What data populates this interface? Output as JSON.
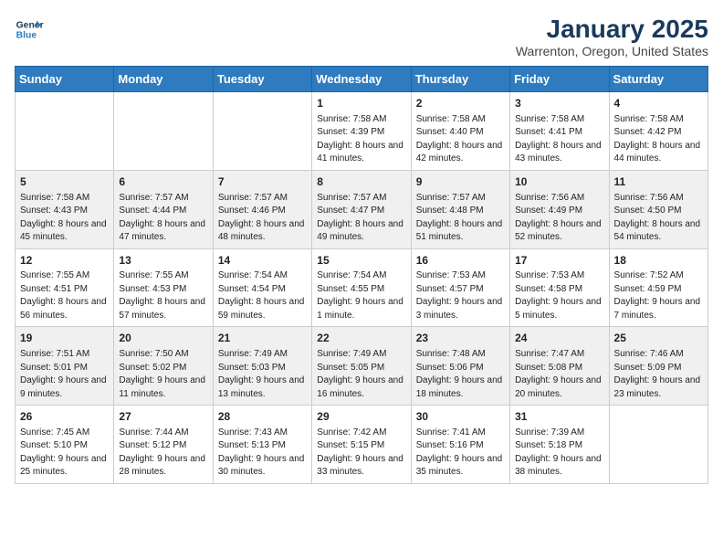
{
  "header": {
    "logo_line1": "General",
    "logo_line2": "Blue",
    "month": "January 2025",
    "location": "Warrenton, Oregon, United States"
  },
  "days_of_week": [
    "Sunday",
    "Monday",
    "Tuesday",
    "Wednesday",
    "Thursday",
    "Friday",
    "Saturday"
  ],
  "weeks": [
    [
      {
        "day": "",
        "info": ""
      },
      {
        "day": "",
        "info": ""
      },
      {
        "day": "",
        "info": ""
      },
      {
        "day": "1",
        "info": "Sunrise: 7:58 AM\nSunset: 4:39 PM\nDaylight: 8 hours and 41 minutes."
      },
      {
        "day": "2",
        "info": "Sunrise: 7:58 AM\nSunset: 4:40 PM\nDaylight: 8 hours and 42 minutes."
      },
      {
        "day": "3",
        "info": "Sunrise: 7:58 AM\nSunset: 4:41 PM\nDaylight: 8 hours and 43 minutes."
      },
      {
        "day": "4",
        "info": "Sunrise: 7:58 AM\nSunset: 4:42 PM\nDaylight: 8 hours and 44 minutes."
      }
    ],
    [
      {
        "day": "5",
        "info": "Sunrise: 7:58 AM\nSunset: 4:43 PM\nDaylight: 8 hours and 45 minutes."
      },
      {
        "day": "6",
        "info": "Sunrise: 7:57 AM\nSunset: 4:44 PM\nDaylight: 8 hours and 47 minutes."
      },
      {
        "day": "7",
        "info": "Sunrise: 7:57 AM\nSunset: 4:46 PM\nDaylight: 8 hours and 48 minutes."
      },
      {
        "day": "8",
        "info": "Sunrise: 7:57 AM\nSunset: 4:47 PM\nDaylight: 8 hours and 49 minutes."
      },
      {
        "day": "9",
        "info": "Sunrise: 7:57 AM\nSunset: 4:48 PM\nDaylight: 8 hours and 51 minutes."
      },
      {
        "day": "10",
        "info": "Sunrise: 7:56 AM\nSunset: 4:49 PM\nDaylight: 8 hours and 52 minutes."
      },
      {
        "day": "11",
        "info": "Sunrise: 7:56 AM\nSunset: 4:50 PM\nDaylight: 8 hours and 54 minutes."
      }
    ],
    [
      {
        "day": "12",
        "info": "Sunrise: 7:55 AM\nSunset: 4:51 PM\nDaylight: 8 hours and 56 minutes."
      },
      {
        "day": "13",
        "info": "Sunrise: 7:55 AM\nSunset: 4:53 PM\nDaylight: 8 hours and 57 minutes."
      },
      {
        "day": "14",
        "info": "Sunrise: 7:54 AM\nSunset: 4:54 PM\nDaylight: 8 hours and 59 minutes."
      },
      {
        "day": "15",
        "info": "Sunrise: 7:54 AM\nSunset: 4:55 PM\nDaylight: 9 hours and 1 minute."
      },
      {
        "day": "16",
        "info": "Sunrise: 7:53 AM\nSunset: 4:57 PM\nDaylight: 9 hours and 3 minutes."
      },
      {
        "day": "17",
        "info": "Sunrise: 7:53 AM\nSunset: 4:58 PM\nDaylight: 9 hours and 5 minutes."
      },
      {
        "day": "18",
        "info": "Sunrise: 7:52 AM\nSunset: 4:59 PM\nDaylight: 9 hours and 7 minutes."
      }
    ],
    [
      {
        "day": "19",
        "info": "Sunrise: 7:51 AM\nSunset: 5:01 PM\nDaylight: 9 hours and 9 minutes."
      },
      {
        "day": "20",
        "info": "Sunrise: 7:50 AM\nSunset: 5:02 PM\nDaylight: 9 hours and 11 minutes."
      },
      {
        "day": "21",
        "info": "Sunrise: 7:49 AM\nSunset: 5:03 PM\nDaylight: 9 hours and 13 minutes."
      },
      {
        "day": "22",
        "info": "Sunrise: 7:49 AM\nSunset: 5:05 PM\nDaylight: 9 hours and 16 minutes."
      },
      {
        "day": "23",
        "info": "Sunrise: 7:48 AM\nSunset: 5:06 PM\nDaylight: 9 hours and 18 minutes."
      },
      {
        "day": "24",
        "info": "Sunrise: 7:47 AM\nSunset: 5:08 PM\nDaylight: 9 hours and 20 minutes."
      },
      {
        "day": "25",
        "info": "Sunrise: 7:46 AM\nSunset: 5:09 PM\nDaylight: 9 hours and 23 minutes."
      }
    ],
    [
      {
        "day": "26",
        "info": "Sunrise: 7:45 AM\nSunset: 5:10 PM\nDaylight: 9 hours and 25 minutes."
      },
      {
        "day": "27",
        "info": "Sunrise: 7:44 AM\nSunset: 5:12 PM\nDaylight: 9 hours and 28 minutes."
      },
      {
        "day": "28",
        "info": "Sunrise: 7:43 AM\nSunset: 5:13 PM\nDaylight: 9 hours and 30 minutes."
      },
      {
        "day": "29",
        "info": "Sunrise: 7:42 AM\nSunset: 5:15 PM\nDaylight: 9 hours and 33 minutes."
      },
      {
        "day": "30",
        "info": "Sunrise: 7:41 AM\nSunset: 5:16 PM\nDaylight: 9 hours and 35 minutes."
      },
      {
        "day": "31",
        "info": "Sunrise: 7:39 AM\nSunset: 5:18 PM\nDaylight: 9 hours and 38 minutes."
      },
      {
        "day": "",
        "info": ""
      }
    ]
  ]
}
